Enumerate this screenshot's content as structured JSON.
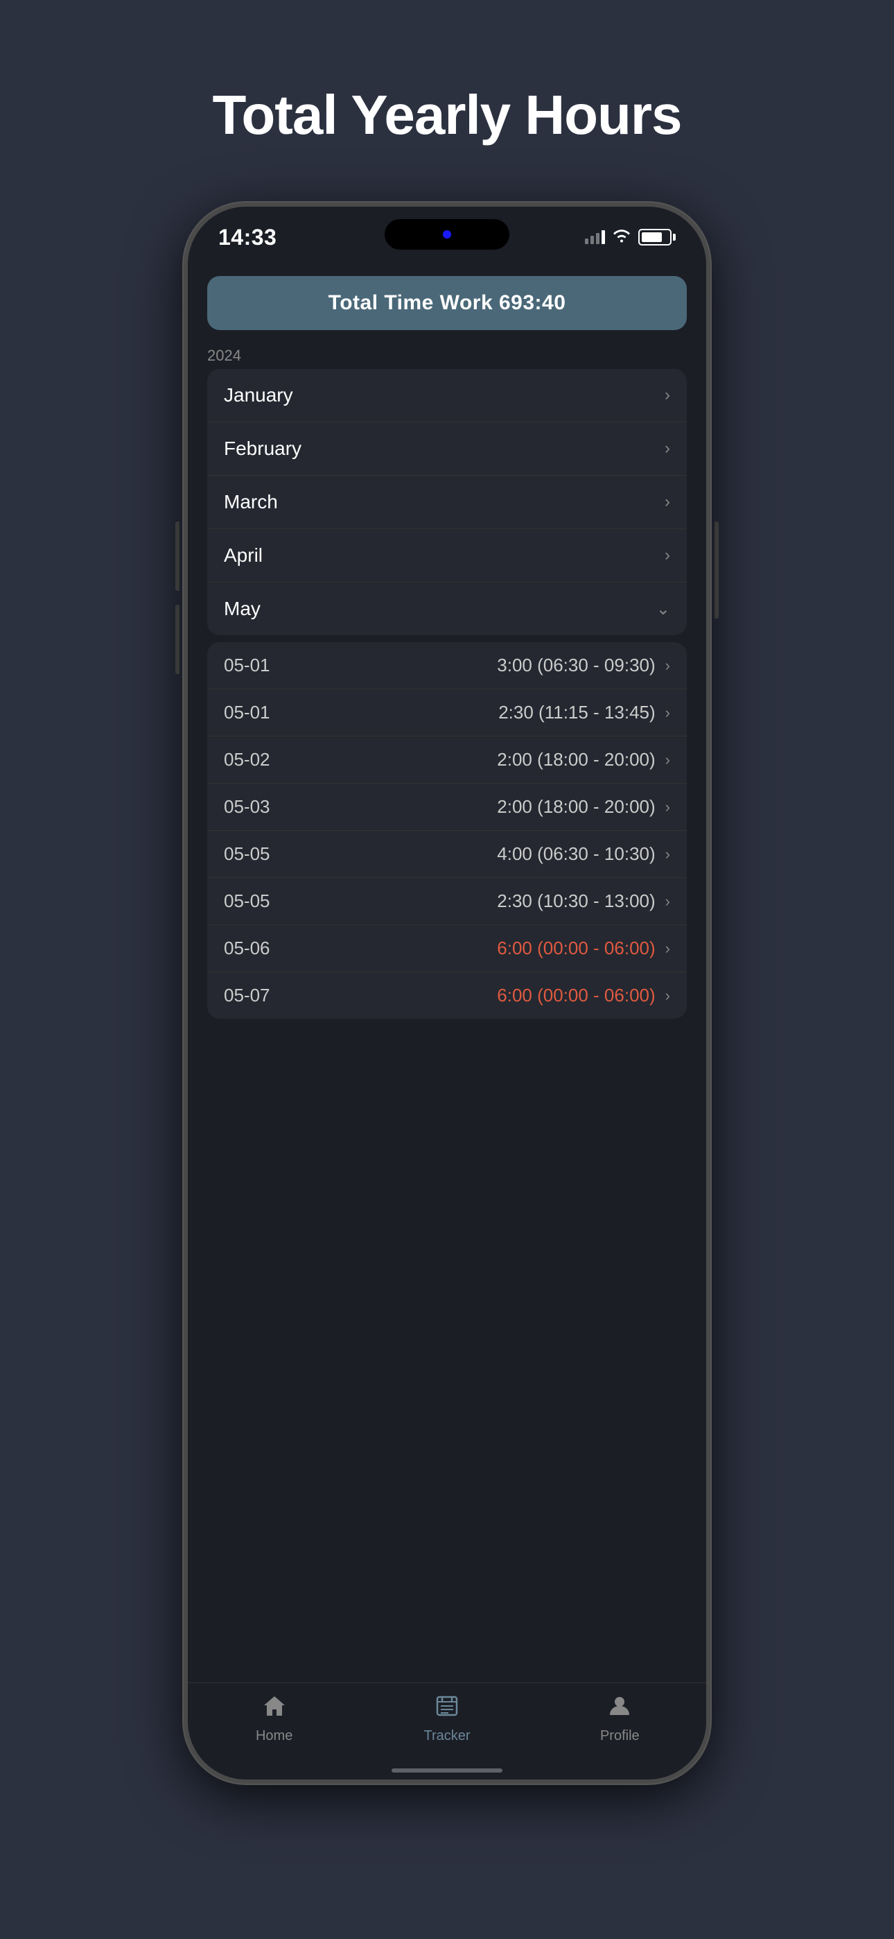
{
  "page": {
    "title": "Total Yearly Hours",
    "background_color": "#2c3140"
  },
  "status_bar": {
    "time": "14:33",
    "signal_label": "signal",
    "wifi_label": "wifi",
    "battery_label": "battery"
  },
  "total_banner": {
    "label": "Total Time Work  693:40"
  },
  "year_label": "2024",
  "months": [
    {
      "name": "January",
      "expanded": false
    },
    {
      "name": "February",
      "expanded": false
    },
    {
      "name": "March",
      "expanded": false
    },
    {
      "name": "April",
      "expanded": false
    },
    {
      "name": "May",
      "expanded": true
    }
  ],
  "entries": [
    {
      "date": "05-01",
      "time": "3:00 (06:30 - 09:30)",
      "highlight": false
    },
    {
      "date": "05-01",
      "time": "2:30 (11:15 - 13:45)",
      "highlight": false
    },
    {
      "date": "05-02",
      "time": "2:00 (18:00 - 20:00)",
      "highlight": false
    },
    {
      "date": "05-03",
      "time": "2:00 (18:00 - 20:00)",
      "highlight": false
    },
    {
      "date": "05-05",
      "time": "4:00 (06:30 - 10:30)",
      "highlight": false
    },
    {
      "date": "05-05",
      "time": "2:30 (10:30 - 13:00)",
      "highlight": false
    },
    {
      "date": "05-06",
      "time": "6:00 (00:00 - 06:00)",
      "highlight": true
    },
    {
      "date": "05-07",
      "time": "6:00 (00:00 - 06:00)",
      "highlight": true
    }
  ],
  "tab_bar": {
    "items": [
      {
        "id": "home",
        "label": "Home",
        "active": false
      },
      {
        "id": "tracker",
        "label": "Tracker",
        "active": true
      },
      {
        "id": "profile",
        "label": "Profile",
        "active": false
      }
    ]
  }
}
